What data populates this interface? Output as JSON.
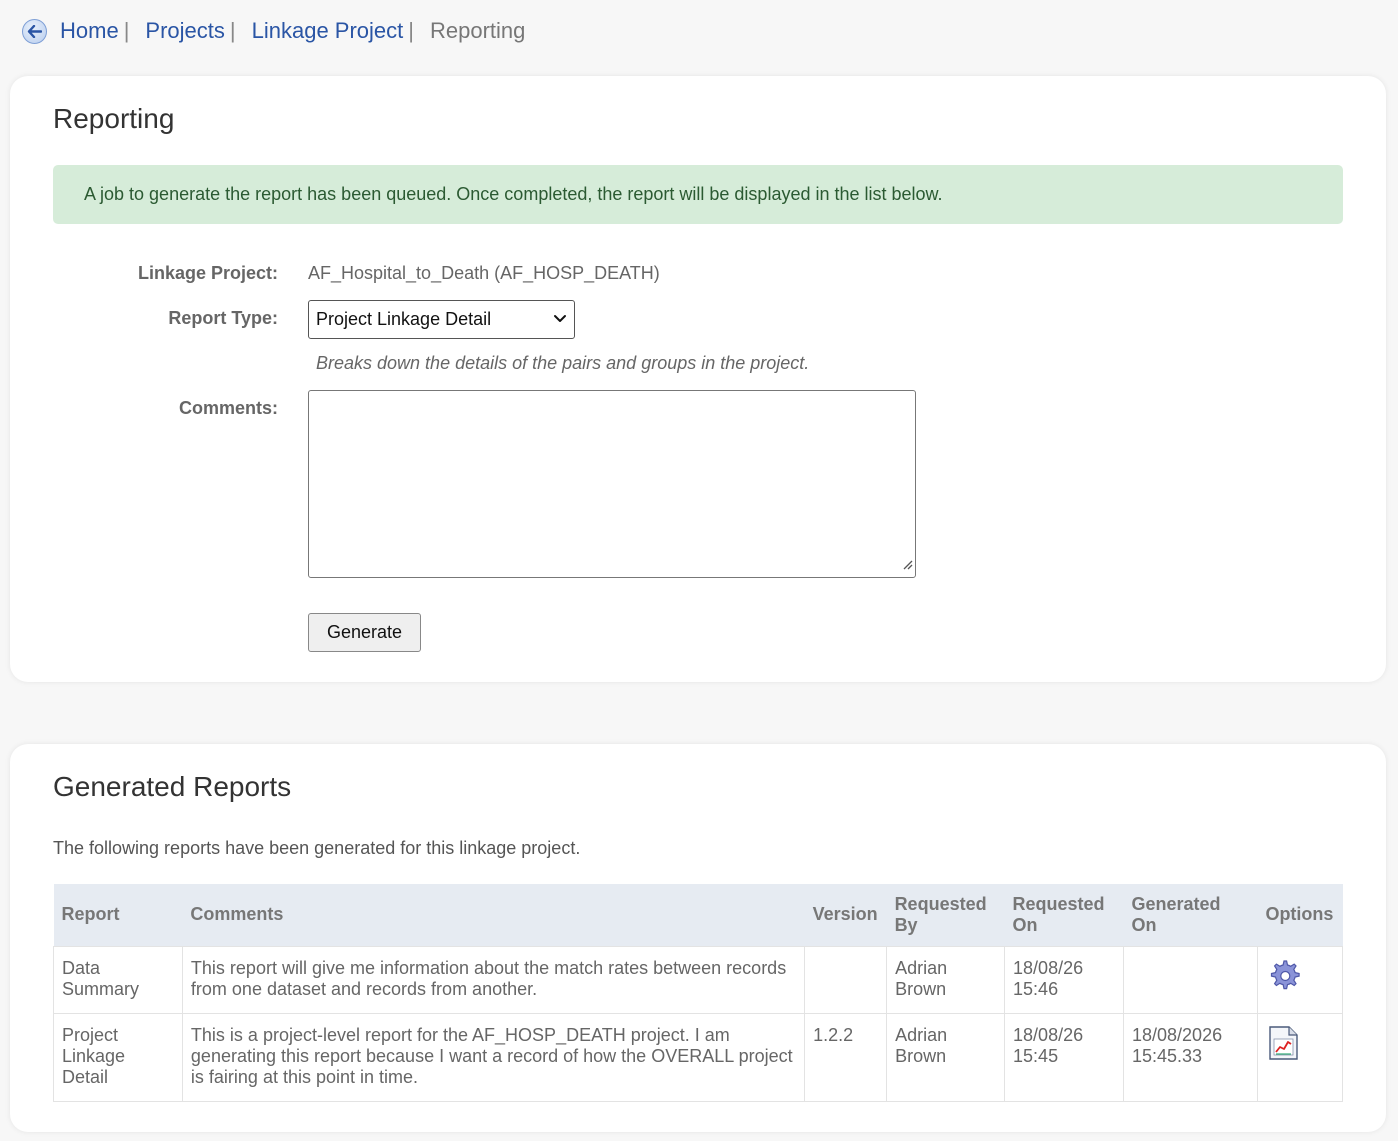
{
  "breadcrumb": {
    "items": [
      {
        "label": "Home"
      },
      {
        "label": "Projects"
      },
      {
        "label": "Linkage Project"
      }
    ],
    "separator": "|",
    "current": "Reporting"
  },
  "reporting": {
    "title": "Reporting",
    "alert": "A job to generate the report has been queued. Once completed, the report will be displayed in the list below.",
    "linkage_project_label": "Linkage Project:",
    "linkage_project_value": "AF_Hospital_to_Death (AF_HOSP_DEATH)",
    "report_type_label": "Report Type:",
    "report_type_selected": "Project Linkage Detail",
    "report_type_help": "Breaks down the details of the pairs and groups in the project.",
    "comments_label": "Comments:",
    "comments_value": "",
    "generate_label": "Generate"
  },
  "generated": {
    "title": "Generated Reports",
    "description": "The following reports have been generated for this linkage project.",
    "columns": {
      "report": "Report",
      "comments": "Comments",
      "version": "Version",
      "requested_by": "Requested By",
      "requested_on": "Requested On",
      "generated_on": "Generated On",
      "options": "Options"
    },
    "rows": [
      {
        "report": "Data Summary",
        "comments": "This report will give me information about the match rates between records from one dataset and records from another.",
        "version": "",
        "requested_by": "Adrian Brown",
        "requested_on": "18/08/26 15:46",
        "generated_on": "",
        "option_icon": "gear-icon"
      },
      {
        "report": "Project Linkage Detail",
        "comments": "This is a project-level report for the AF_HOSP_DEATH project. I am generating this report because I want a record of how the OVERALL project is fairing at this point in time.",
        "version": "1.2.2",
        "requested_by": "Adrian Brown",
        "requested_on": "18/08/26 15:45",
        "generated_on": "18/08/2026 15:45.33",
        "option_icon": "report-chart-icon"
      }
    ]
  },
  "colors": {
    "link": "#2a55a5",
    "alert_bg": "#d6ecd9",
    "alert_text": "#2b5a32",
    "table_header_bg": "#e6ebf2"
  }
}
